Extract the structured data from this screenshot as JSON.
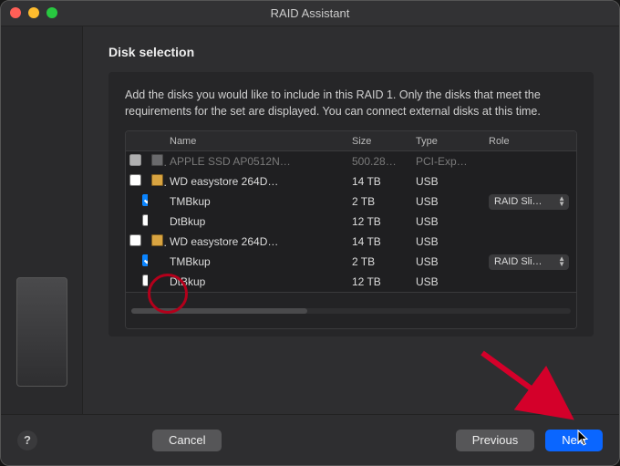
{
  "window": {
    "title": "RAID Assistant"
  },
  "section_title": "Disk selection",
  "description": "Add the disks you would like to include in this RAID 1. Only the disks that meet the requirements for the set are displayed. You can connect external disks at this time.",
  "columns": {
    "name": "Name",
    "size": "Size",
    "type": "Type",
    "role": "Role"
  },
  "rows": [
    {
      "indent": 0,
      "checked": false,
      "disabled": true,
      "icon": "internal",
      "name": "APPLE SSD AP0512N…",
      "size": "500.28…",
      "type": "PCI-Exp…",
      "role": ""
    },
    {
      "indent": 0,
      "checked": false,
      "disabled": false,
      "icon": "external",
      "name": "WD easystore 264D…",
      "size": "14 TB",
      "type": "USB",
      "role": ""
    },
    {
      "indent": 1,
      "checked": true,
      "disabled": false,
      "icon": "",
      "name": "TMBkup",
      "size": "2 TB",
      "type": "USB",
      "role": "RAID Sli…"
    },
    {
      "indent": 1,
      "checked": false,
      "disabled": false,
      "icon": "",
      "name": "DtBkup",
      "size": "12 TB",
      "type": "USB",
      "role": ""
    },
    {
      "indent": 0,
      "checked": false,
      "disabled": false,
      "icon": "external",
      "name": "WD easystore 264D…",
      "size": "14 TB",
      "type": "USB",
      "role": ""
    },
    {
      "indent": 1,
      "checked": true,
      "disabled": false,
      "icon": "",
      "name": "TMBkup",
      "size": "2 TB",
      "type": "USB",
      "role": "RAID Sli…"
    },
    {
      "indent": 1,
      "checked": false,
      "disabled": false,
      "icon": "",
      "name": "DtBkup",
      "size": "12 TB",
      "type": "USB",
      "role": ""
    }
  ],
  "buttons": {
    "help": "?",
    "cancel": "Cancel",
    "previous": "Previous",
    "next": "Next"
  },
  "annotation": {
    "circle_target_row": 5,
    "arrow_target": "next-button"
  }
}
